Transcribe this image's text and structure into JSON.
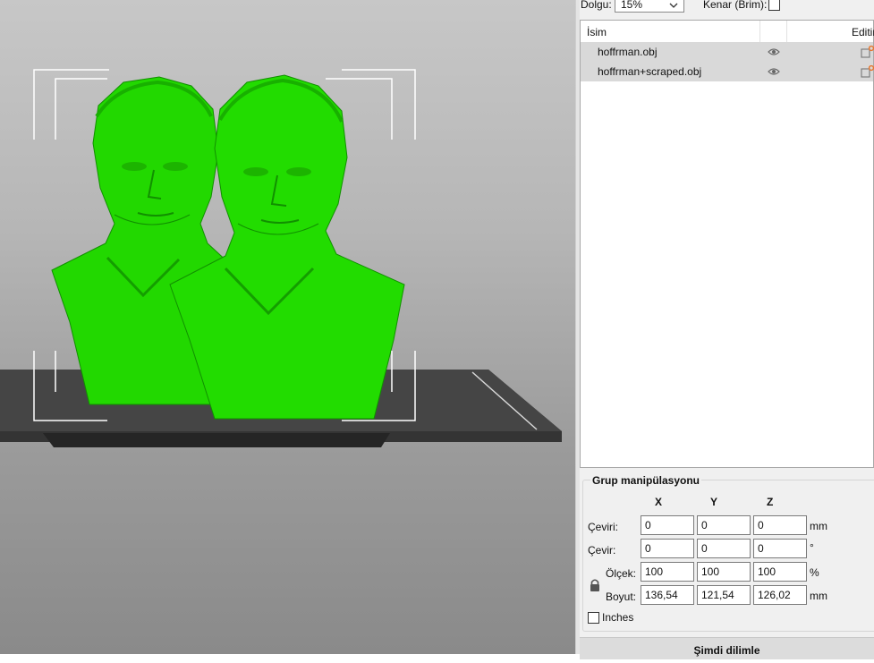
{
  "settings": {
    "infill_label": "Dolgu:",
    "infill_value": "15%",
    "brim_label": "Kenar (Brim):",
    "brim_checked": false
  },
  "object_list": {
    "columns": {
      "name": "İsim",
      "edit": "Editing"
    },
    "items": [
      {
        "name": "hoffrman.obj",
        "visible_icon": "eye-icon",
        "edit_icon": "edit-icon"
      },
      {
        "name": "hoffrman+scraped.obj",
        "visible_icon": "eye-icon",
        "edit_icon": "edit-icon"
      }
    ]
  },
  "group_manipulation": {
    "title": "Grup manipülasyonu",
    "axes": [
      "X",
      "Y",
      "Z"
    ],
    "rows": [
      {
        "label": "Çeviri:",
        "values": [
          "0",
          "0",
          "0"
        ],
        "unit": "mm"
      },
      {
        "label": "Çevir:",
        "values": [
          "0",
          "0",
          "0"
        ],
        "unit": "°"
      },
      {
        "label": "Ölçek:",
        "values": [
          "100",
          "100",
          "100"
        ],
        "unit": "%"
      },
      {
        "label": "Boyut:",
        "values": [
          "136,54",
          "121,54",
          "126,02"
        ],
        "unit": "mm"
      }
    ],
    "lock_icon": "lock-icon",
    "inches_label": "Inches",
    "inches_checked": false
  },
  "slice_button": "Şimdi dilimle",
  "colors": {
    "model": "#22e000",
    "bed": "#3a3a3a",
    "panel": "#f0f0f0",
    "selected_row": "#d9d9d9",
    "edit_accent": "#e8742a"
  }
}
